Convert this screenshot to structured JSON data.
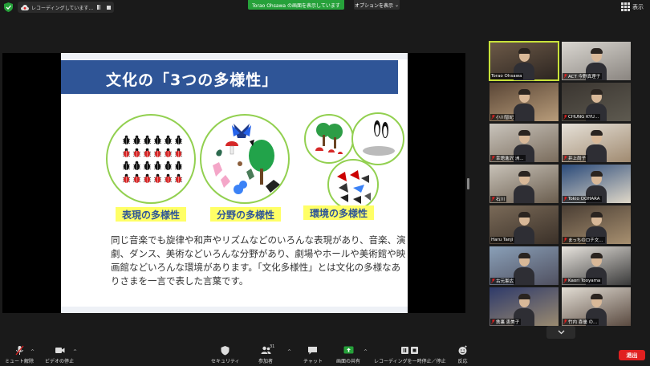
{
  "topbar": {
    "recording_label": "レコーディングしています...",
    "share_banner": "Torao Ohsawa の画面を表示しています",
    "view_options_label": "オプションを表示",
    "view_label": "表示"
  },
  "slide": {
    "title": "文化の「3つの多様性」",
    "labels": [
      "表現の多様性",
      "分野の多様性",
      "環境の多様性"
    ],
    "body": "同じ音楽でも旋律や和声やリズムなどのいろんな表現があり、音楽、演劇、ダンス、美術などいろんな分野があり、劇場やホールや美術館や映画館などいろんな環境があります。「文化多様性」とは文化の多様なありさまを一言で表した言葉です。"
  },
  "participants": [
    {
      "name": "Torao Ohsawa",
      "muted": false,
      "active": true
    },
    {
      "name": "ACT 今野真理子",
      "muted": true,
      "active": false
    },
    {
      "name": "小川智紀",
      "muted": true,
      "active": false
    },
    {
      "name": "CHUNG KYU...",
      "muted": true,
      "active": false
    },
    {
      "name": "幸語進沢 洲...",
      "muted": true,
      "active": false
    },
    {
      "name": "井上尚子",
      "muted": true,
      "active": false
    },
    {
      "name": "石川",
      "muted": true,
      "active": false
    },
    {
      "name": "Tokio OOHARA",
      "muted": true,
      "active": false
    },
    {
      "name": "Haru Tanji",
      "muted": false,
      "active": false
    },
    {
      "name": "まっちのロチ文...",
      "muted": true,
      "active": false
    },
    {
      "name": "古元憲広",
      "muted": true,
      "active": false
    },
    {
      "name": "Kaori Tooyama",
      "muted": true,
      "active": false
    },
    {
      "name": "鉄裏 恵美子",
      "muted": true,
      "active": false
    },
    {
      "name": "竹内 喜優 の...",
      "muted": true,
      "active": false
    }
  ],
  "toolbar": {
    "unmute": "ミュート解除",
    "video": "ビデオの停止",
    "security": "セキュリティ",
    "participants": "参加者",
    "participants_count": "31",
    "chat": "チャット",
    "share": "画面の共有",
    "recording": "レコーディングを一時停止／停止",
    "reactions": "反応",
    "end": "退出"
  },
  "colors": {
    "share_green": "#26a13a",
    "slide_blue": "#2f5597",
    "circle_green": "#92d050",
    "label_yellow": "#ffff66",
    "end_red": "#e02020",
    "active_outline": "#c8e23a"
  }
}
